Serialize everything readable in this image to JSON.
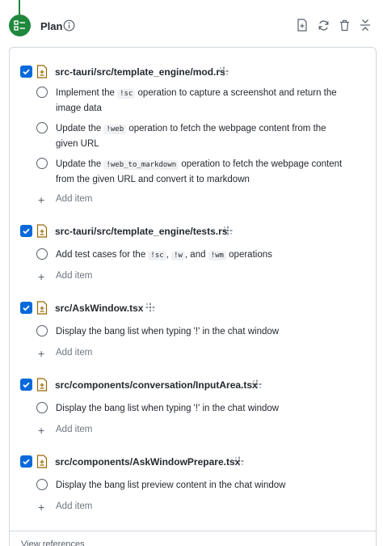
{
  "header": {
    "title": "Plan",
    "icons": [
      "checklist-icon",
      "info-icon",
      "new-file-icon",
      "refresh-icon",
      "trash-icon",
      "collapse-icon"
    ]
  },
  "colors": {
    "accent": "#1f883d",
    "checkbox": "#0969da",
    "muted": "#6e7781"
  },
  "add_label": "Add item",
  "files": [
    {
      "path": "src-tauri/src/template_engine/mod.rs",
      "checked": true,
      "tasks": [
        {
          "parts": [
            "Implement the ",
            {
              "code": "!sc"
            },
            " operation to capture a screenshot and return the image data"
          ]
        },
        {
          "parts": [
            "Update the ",
            {
              "code": "!web"
            },
            " operation to fetch the webpage content from the given URL"
          ]
        },
        {
          "parts": [
            "Update the ",
            {
              "code": "!web_to_markdown"
            },
            " operation to fetch the webpage content from the given URL and convert it to markdown"
          ]
        }
      ]
    },
    {
      "path": "src-tauri/src/template_engine/tests.rs",
      "checked": true,
      "tasks": [
        {
          "parts": [
            "Add test cases for the ",
            {
              "code": "!sc"
            },
            ", ",
            {
              "code": "!w"
            },
            ", and ",
            {
              "code": "!wm"
            },
            " operations"
          ]
        }
      ]
    },
    {
      "path": "src/AskWindow.tsx",
      "checked": true,
      "tasks": [
        {
          "parts": [
            "Display the bang list when typing '!' in the chat window"
          ]
        }
      ]
    },
    {
      "path": "src/components/conversation/InputArea.tsx",
      "checked": true,
      "tasks": [
        {
          "parts": [
            "Display the bang list when typing '!' in the chat window"
          ]
        }
      ]
    },
    {
      "path": "src/components/AskWindowPrepare.tsx",
      "checked": true,
      "tasks": [
        {
          "parts": [
            "Display the bang list preview content in the chat window"
          ]
        }
      ]
    }
  ],
  "footer": {
    "view_references": "View references"
  }
}
